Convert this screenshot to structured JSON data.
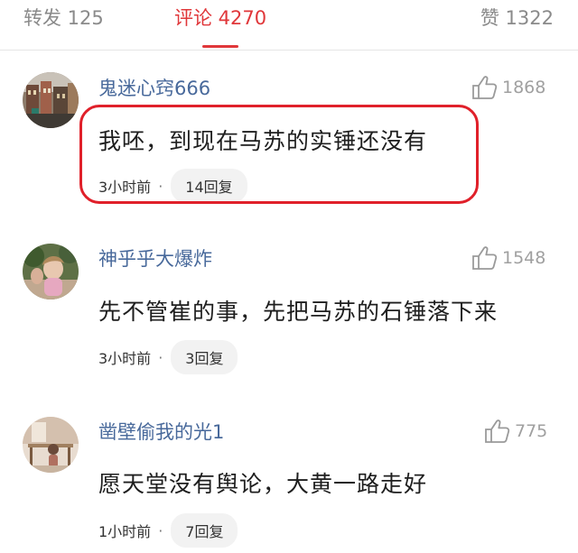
{
  "tabs": {
    "repost": "转发 125",
    "comments": "评论 4270",
    "likes": "赞 1322"
  },
  "accent_color": "#e0373a",
  "comments": [
    {
      "username": "鬼迷心窍666",
      "likes": "1868",
      "text": "我呸，到现在马苏的实锤还没有",
      "time": "3小时前",
      "replies": "14回复",
      "avatar_icon": "street-photo-avatar"
    },
    {
      "username": "神乎乎大爆炸",
      "likes": "1548",
      "text": "先不管崔的事，先把马苏的石锤落下来",
      "time": "3小时前",
      "replies": "3回复",
      "avatar_icon": "child-photo-avatar"
    },
    {
      "username": "凿壁偷我的光1",
      "likes": "775",
      "text": "愿天堂没有舆论，大黄一路走好",
      "time": "1小时前",
      "replies": "7回复",
      "avatar_icon": "illustration-avatar"
    }
  ]
}
